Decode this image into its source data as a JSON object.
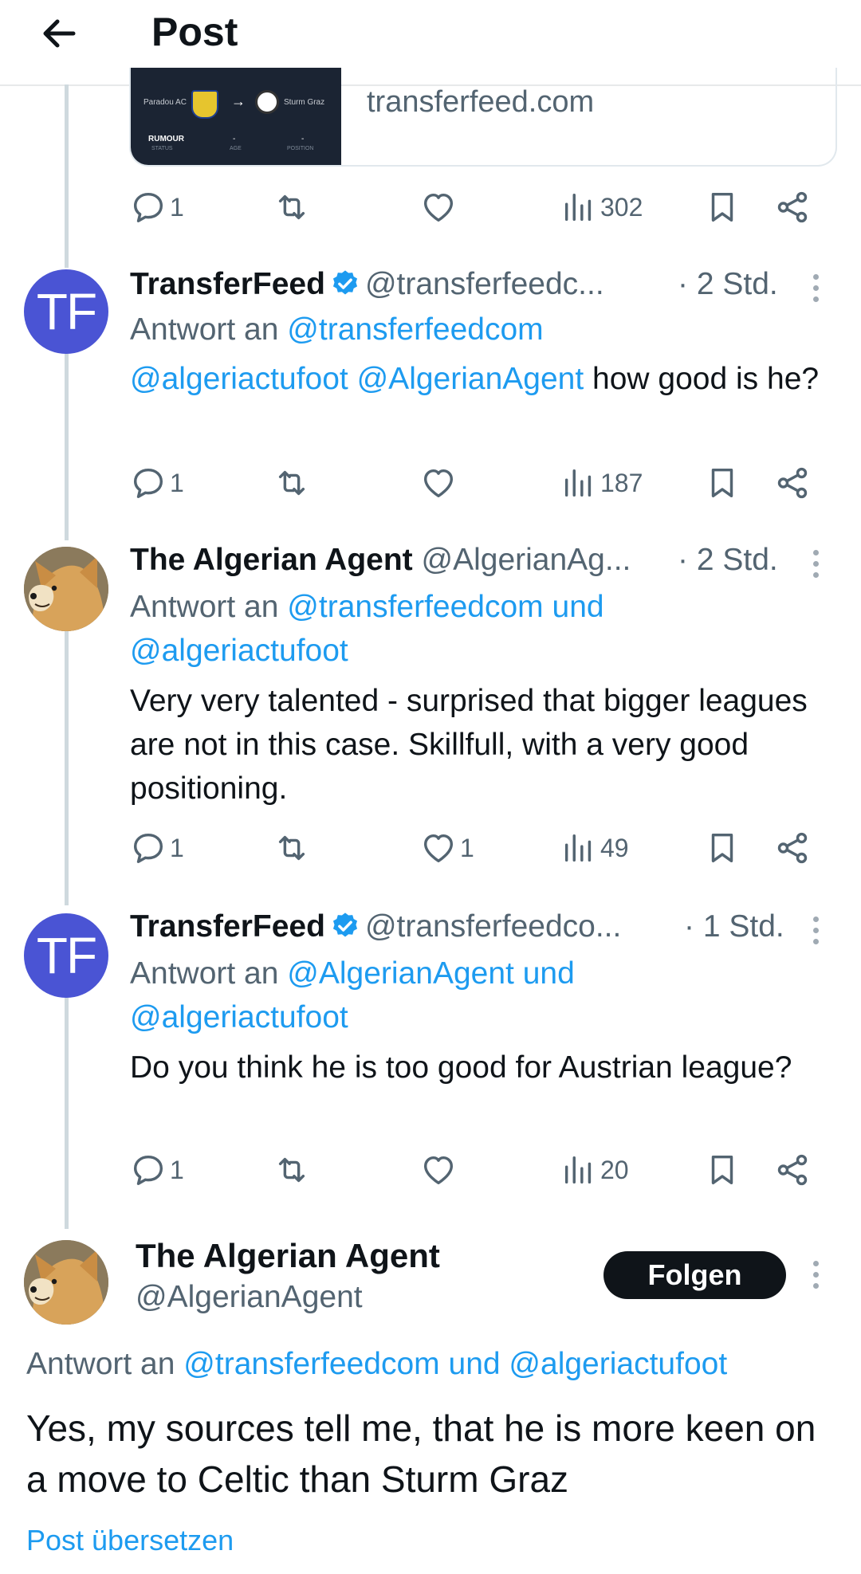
{
  "header": {
    "title": "Post",
    "back_icon": "arrow-left-icon"
  },
  "link_card": {
    "domain": "transferfeed.com",
    "thumb": {
      "team_from": "Paradou AC",
      "team_to": "Sturm Graz",
      "status": "RUMOUR",
      "status_label": "STATUS",
      "age_value": "-",
      "age_label": "AGE",
      "position_value": "-",
      "position_label": "POSITION"
    },
    "reply_count": "1",
    "retweet_count": "",
    "like_count": "",
    "views": "302"
  },
  "replies": [
    {
      "avatar": "TF",
      "name": "TransferFeed",
      "handle": "@transferfeedc...",
      "time": "· 2 Std.",
      "reply_prefix": "Antwort an",
      "reply_to": "@transferfeedcom",
      "mention1": "@algeriactufoot",
      "mention2": "@AlgerianAgent",
      "text": "how good is he?",
      "reply_count": "1",
      "like_count": "",
      "views": "187"
    },
    {
      "name": "The Algerian Agent",
      "handle": "@AlgerianAg...",
      "time": "· 2 Std.",
      "reply_prefix": "Antwort an",
      "reply_to_line1": "@transferfeedcom und",
      "reply_to_line2": "@algeriactufoot",
      "text": "Very very talented - surprised that bigger leagues are not in this case. Skillfull, with a very good positioning.",
      "reply_count": "1",
      "like_count": "1",
      "views": "49"
    },
    {
      "avatar": "TF",
      "name": "TransferFeed",
      "handle": "@transferfeedco...",
      "time": "· 1 Std.",
      "reply_prefix": "Antwort an",
      "reply_to_line1": "@AlgerianAgent und",
      "reply_to_line2": "@algeriactufoot",
      "text": "Do you think he is too good for Austrian league?",
      "reply_count": "1",
      "like_count": "",
      "views": "20"
    }
  ],
  "main_post": {
    "name": "The Algerian Agent",
    "handle": "@AlgerianAgent",
    "follow_label": "Folgen",
    "reply_prefix": "Antwort an",
    "reply_to": "@transferfeedcom und @algeriactufoot",
    "text": "Yes, my sources tell me, that he is more keen on a move to Celtic than Sturm Graz",
    "translate_label": "Post übersetzen"
  },
  "colors": {
    "link": "#1d9bf0",
    "secondary_text": "#536471",
    "primary_text": "#0f1419",
    "tf_avatar": "#4a54d4",
    "verified": "#1d9bf0"
  }
}
